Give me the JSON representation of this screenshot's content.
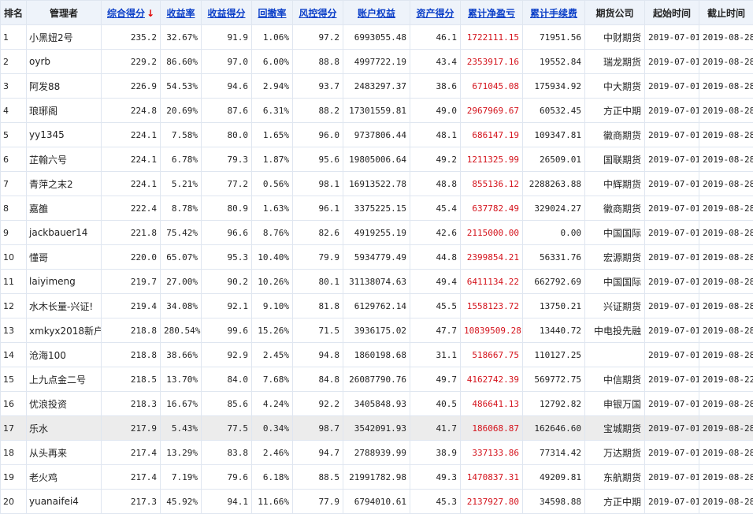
{
  "headers": {
    "rank": "排名",
    "manager": "管理者",
    "score": "综合得分",
    "score_sort_arrow": "↓",
    "return_rate": "收益率",
    "return_score": "收益得分",
    "drawdown": "回撤率",
    "risk_score": "风控得分",
    "equity": "账户权益",
    "asset_score": "资产得分",
    "net_profit": "累计净盈亏",
    "fee": "累计手续费",
    "broker": "期货公司",
    "start": "起始时间",
    "end": "截止时间"
  },
  "colors": {
    "link": "#0b3fc8",
    "profit": "#d4121b",
    "highlight_row": "#ececec",
    "header_bg": "#eef3fa"
  },
  "rows": [
    {
      "rank": "1",
      "manager": "小黑妞2号",
      "score": "235.2",
      "return_rate": "32.67%",
      "return_score": "91.9",
      "drawdown": "1.06%",
      "risk_score": "97.2",
      "equity": "6993055.48",
      "asset_score": "46.1",
      "net_profit": "1722111.15",
      "fee": "71951.56",
      "broker": "中财期货",
      "start": "2019-07-01",
      "end": "2019-08-28"
    },
    {
      "rank": "2",
      "manager": "oyrb",
      "score": "229.2",
      "return_rate": "86.60%",
      "return_score": "97.0",
      "drawdown": "6.00%",
      "risk_score": "88.8",
      "equity": "4997722.19",
      "asset_score": "43.4",
      "net_profit": "2353917.16",
      "fee": "19552.84",
      "broker": "瑞龙期货",
      "start": "2019-07-01",
      "end": "2019-08-28"
    },
    {
      "rank": "3",
      "manager": "阿发88",
      "score": "226.9",
      "return_rate": "54.53%",
      "return_score": "94.6",
      "drawdown": "2.94%",
      "risk_score": "93.7",
      "equity": "2483297.37",
      "asset_score": "38.6",
      "net_profit": "671045.08",
      "fee": "175934.92",
      "broker": "中大期货",
      "start": "2019-07-01",
      "end": "2019-08-28"
    },
    {
      "rank": "4",
      "manager": "琅琊阁",
      "score": "224.8",
      "return_rate": "20.69%",
      "return_score": "87.6",
      "drawdown": "6.31%",
      "risk_score": "88.2",
      "equity": "17301559.81",
      "asset_score": "49.0",
      "net_profit": "2967969.67",
      "fee": "60532.45",
      "broker": "方正中期",
      "start": "2019-07-01",
      "end": "2019-08-28"
    },
    {
      "rank": "5",
      "manager": "yy1345",
      "score": "224.1",
      "return_rate": "7.58%",
      "return_score": "80.0",
      "drawdown": "1.65%",
      "risk_score": "96.0",
      "equity": "9737806.44",
      "asset_score": "48.1",
      "net_profit": "686147.19",
      "fee": "109347.81",
      "broker": "徽商期货",
      "start": "2019-07-01",
      "end": "2019-08-28"
    },
    {
      "rank": "6",
      "manager": "芷翰六号",
      "score": "224.1",
      "return_rate": "6.78%",
      "return_score": "79.3",
      "drawdown": "1.87%",
      "risk_score": "95.6",
      "equity": "19805006.64",
      "asset_score": "49.2",
      "net_profit": "1211325.99",
      "fee": "26509.01",
      "broker": "国联期货",
      "start": "2019-07-01",
      "end": "2019-08-28"
    },
    {
      "rank": "7",
      "manager": "青萍之末2",
      "score": "224.1",
      "return_rate": "5.21%",
      "return_score": "77.2",
      "drawdown": "0.56%",
      "risk_score": "98.1",
      "equity": "16913522.78",
      "asset_score": "48.8",
      "net_profit": "855136.12",
      "fee": "2288263.88",
      "broker": "中辉期货",
      "start": "2019-07-01",
      "end": "2019-08-28"
    },
    {
      "rank": "8",
      "manager": "嘉雒",
      "score": "222.4",
      "return_rate": "8.78%",
      "return_score": "80.9",
      "drawdown": "1.63%",
      "risk_score": "96.1",
      "equity": "3375225.15",
      "asset_score": "45.4",
      "net_profit": "637782.49",
      "fee": "329024.27",
      "broker": "徽商期货",
      "start": "2019-07-01",
      "end": "2019-08-28"
    },
    {
      "rank": "9",
      "manager": "jackbauer14",
      "score": "221.8",
      "return_rate": "75.42%",
      "return_score": "96.6",
      "drawdown": "8.76%",
      "risk_score": "82.6",
      "equity": "4919255.19",
      "asset_score": "42.6",
      "net_profit": "2115000.00",
      "fee": "0.00",
      "broker": "中国国际",
      "start": "2019-07-01",
      "end": "2019-08-28"
    },
    {
      "rank": "10",
      "manager": "懂哥",
      "score": "220.0",
      "return_rate": "65.07%",
      "return_score": "95.3",
      "drawdown": "10.40%",
      "risk_score": "79.9",
      "equity": "5934779.49",
      "asset_score": "44.8",
      "net_profit": "2399854.21",
      "fee": "56331.76",
      "broker": "宏源期货",
      "start": "2019-07-01",
      "end": "2019-08-28"
    },
    {
      "rank": "11",
      "manager": "laiyimeng",
      "score": "219.7",
      "return_rate": "27.00%",
      "return_score": "90.2",
      "drawdown": "10.26%",
      "risk_score": "80.1",
      "equity": "31138074.63",
      "asset_score": "49.4",
      "net_profit": "6411134.22",
      "fee": "662792.69",
      "broker": "中国国际",
      "start": "2019-07-01",
      "end": "2019-08-28"
    },
    {
      "rank": "12",
      "manager": "水木长量-兴证!",
      "score": "219.4",
      "return_rate": "34.08%",
      "return_score": "92.1",
      "drawdown": "9.10%",
      "risk_score": "81.8",
      "equity": "6129762.14",
      "asset_score": "45.5",
      "net_profit": "1558123.72",
      "fee": "13750.21",
      "broker": "兴证期货",
      "start": "2019-07-01",
      "end": "2019-08-28"
    },
    {
      "rank": "13",
      "manager": "xmkyx2018新户",
      "score": "218.8",
      "return_rate": "280.54%",
      "return_score": "99.6",
      "drawdown": "15.26%",
      "risk_score": "71.5",
      "equity": "3936175.02",
      "asset_score": "47.7",
      "net_profit": "10839509.28",
      "fee": "13440.72",
      "broker": "中电投先融",
      "start": "2019-07-01",
      "end": "2019-08-28"
    },
    {
      "rank": "14",
      "manager": "沧海100",
      "score": "218.8",
      "return_rate": "38.66%",
      "return_score": "92.9",
      "drawdown": "2.45%",
      "risk_score": "94.8",
      "equity": "1860198.68",
      "asset_score": "31.1",
      "net_profit": "518667.75",
      "fee": "110127.25",
      "broker": "",
      "start": "2019-07-01",
      "end": "2019-08-28"
    },
    {
      "rank": "15",
      "manager": "上九点金二号",
      "score": "218.5",
      "return_rate": "13.70%",
      "return_score": "84.0",
      "drawdown": "7.68%",
      "risk_score": "84.8",
      "equity": "26087790.76",
      "asset_score": "49.7",
      "net_profit": "4162742.39",
      "fee": "569772.75",
      "broker": "中信期货",
      "start": "2019-07-01",
      "end": "2019-08-22"
    },
    {
      "rank": "16",
      "manager": "优浪投资",
      "score": "218.3",
      "return_rate": "16.67%",
      "return_score": "85.6",
      "drawdown": "4.24%",
      "risk_score": "92.2",
      "equity": "3405848.93",
      "asset_score": "40.5",
      "net_profit": "486641.13",
      "fee": "12792.82",
      "broker": "申银万国",
      "start": "2019-07-01",
      "end": "2019-08-28"
    },
    {
      "rank": "17",
      "manager": "乐水",
      "score": "217.9",
      "return_rate": "5.43%",
      "return_score": "77.5",
      "drawdown": "0.34%",
      "risk_score": "98.7",
      "equity": "3542091.93",
      "asset_score": "41.7",
      "net_profit": "186068.87",
      "fee": "162646.60",
      "broker": "宝城期货",
      "start": "2019-07-01",
      "end": "2019-08-28",
      "highlight": true
    },
    {
      "rank": "18",
      "manager": "从头再来",
      "score": "217.4",
      "return_rate": "13.29%",
      "return_score": "83.8",
      "drawdown": "2.46%",
      "risk_score": "94.7",
      "equity": "2788939.99",
      "asset_score": "38.9",
      "net_profit": "337133.86",
      "fee": "77314.42",
      "broker": "万达期货",
      "start": "2019-07-01",
      "end": "2019-08-28"
    },
    {
      "rank": "19",
      "manager": "老火鸡",
      "score": "217.4",
      "return_rate": "7.19%",
      "return_score": "79.6",
      "drawdown": "6.18%",
      "risk_score": "88.5",
      "equity": "21991782.98",
      "asset_score": "49.3",
      "net_profit": "1470837.31",
      "fee": "49209.81",
      "broker": "东航期货",
      "start": "2019-07-01",
      "end": "2019-08-28"
    },
    {
      "rank": "20",
      "manager": "yuanaifei4",
      "score": "217.3",
      "return_rate": "45.92%",
      "return_score": "94.1",
      "drawdown": "11.66%",
      "risk_score": "77.9",
      "equity": "6794010.61",
      "asset_score": "45.3",
      "net_profit": "2137927.80",
      "fee": "34598.88",
      "broker": "方正中期",
      "start": "2019-07-01",
      "end": "2019-08-28"
    }
  ]
}
